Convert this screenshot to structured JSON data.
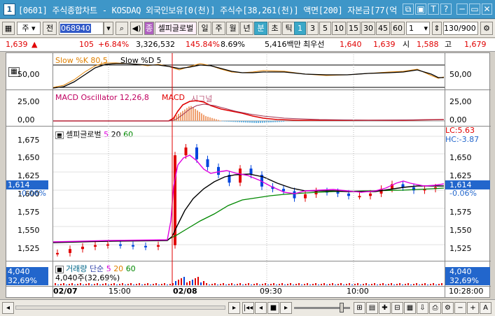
{
  "window": {
    "icon_label": "1",
    "title": "[0601] 주식종합차트 - KOSDAQ 외국인보유[0(천)] 주식수[38,261(천)] 액면[200] 자본금[77(억",
    "buttons": [
      "⧉",
      "▣",
      "T",
      "?",
      "─",
      "▭"
    ]
  },
  "toolbar": {
    "market": "주",
    "type": "전",
    "code": "068940",
    "settings_label": "셀피글로벌",
    "periods": [
      "일",
      "주",
      "월",
      "년",
      "분",
      "초",
      "틱"
    ],
    "active_period": "분",
    "intervals": [
      "1",
      "3",
      "5",
      "10",
      "15",
      "30",
      "45",
      "60"
    ],
    "active_interval": "1",
    "unit_select": "1",
    "count": "130/900"
  },
  "quote": {
    "price": "1,639",
    "change_arrow": "▲",
    "change": "105",
    "change_pct": "+6.84%",
    "volume": "3,326,532",
    "volume_ratio": "145.84%",
    "turnover": "8.69%",
    "amount": "5,416백만",
    "best_label": "최우선",
    "best_ask": "1,640",
    "best_bid": "1,639",
    "open_label": "시",
    "open": "1,588",
    "high_label": "고",
    "high": "1,679"
  },
  "panels": {
    "slow": {
      "label_k": "Slow %K 80,5",
      "label_d": "Slow %D 5",
      "left_tick": "50,00",
      "right_tick": "50,00"
    },
    "macd": {
      "label_osc": "MACD Oscillator 12,26,8",
      "label_macd": "MACD",
      "label_signal": "시그널",
      "left_ticks": [
        "25,00",
        "0,00"
      ],
      "right_ticks": [
        "25,00",
        "0,00"
      ]
    },
    "price": {
      "title": "셀피글로벌",
      "ma_short": "5",
      "ma_mid": "20",
      "ma_long": "60",
      "left_ticks": [
        "1,675",
        "1,650",
        "1,625",
        "1,600",
        "1,575",
        "1,550",
        "1,525"
      ],
      "right_ticks": [
        "1,650",
        "1,625",
        "1,575",
        "1,550",
        "1,525"
      ],
      "current_left": "1,614",
      "current_left_pct": "-0.06%",
      "current_right": "1,614",
      "current_right_pct": "-0.06%",
      "lc": "LC:5.63",
      "hc": "HC:-3.87"
    },
    "volume": {
      "label": "거래량",
      "label_ma": "단순",
      "ma_short": "5",
      "ma_mid": "20",
      "ma_long": "60",
      "summary": "4,040주(32,69%)",
      "left_value": "4,040",
      "left_pct": "32,69%",
      "right_value": "4,040",
      "right_pct": "32,69%"
    },
    "time_axis": {
      "labels": [
        "02/07",
        "15:00",
        "02/08",
        "09:30",
        "10:00"
      ],
      "current_time": "10:28:00"
    }
  },
  "colors": {
    "title_bar": "#3e96c8",
    "up": "#e00000",
    "down": "#0044dd",
    "ma5": "#ff00ff",
    "ma20": "#000000",
    "ma60": "#008800",
    "slow_k": "#e08000",
    "macd": "#e00000",
    "highlight": "#2266cc"
  },
  "chart_data": {
    "type": "line",
    "series": [
      {
        "name": "셀피글로벌",
        "values": [
          1530,
          1535,
          1538,
          1540,
          1541,
          1540,
          1539,
          1538,
          1540,
          1655,
          1665,
          1650,
          1640,
          1630,
          1620,
          1638,
          1630,
          1615,
          1612,
          1609,
          1600,
          1605,
          1609,
          1608,
          1606,
          1603,
          1603,
          1606,
          1612,
          1618,
          1614,
          1610,
          1612,
          1614
        ]
      },
      {
        "name": "5",
        "values": [
          1532,
          1534,
          1537,
          1539,
          1540,
          1540,
          1540,
          1539,
          1539,
          1560,
          1620,
          1640,
          1645,
          1635,
          1625,
          1630,
          1628,
          1620,
          1614,
          1610,
          1604,
          1604,
          1606,
          1607,
          1606,
          1604,
          1604,
          1605,
          1609,
          1614,
          1615,
          1613,
          1612,
          1613
        ]
      },
      {
        "name": "20",
        "values": [
          1535,
          1536,
          1537,
          1538,
          1539,
          1540,
          1540,
          1540,
          1540,
          1550,
          1575,
          1595,
          1610,
          1618,
          1622,
          1624,
          1623,
          1620,
          1617,
          1613,
          1609,
          1607,
          1606,
          1606,
          1606,
          1605,
          1605,
          1605,
          1606,
          1608,
          1610,
          1611,
          1612,
          1612
        ]
      },
      {
        "name": "60",
        "values": [
          1537,
          1537,
          1538,
          1538,
          1539,
          1539,
          1539,
          1540,
          1540,
          1545,
          1560,
          1570,
          1578,
          1584,
          1589,
          1592,
          1594,
          1596,
          1598,
          1599,
          1600,
          1601,
          1601,
          1602,
          1602,
          1602,
          1603,
          1603,
          1604,
          1605,
          1606,
          1607,
          1608,
          1609
        ]
      }
    ],
    "ylim": [
      1520,
      1690
    ]
  }
}
